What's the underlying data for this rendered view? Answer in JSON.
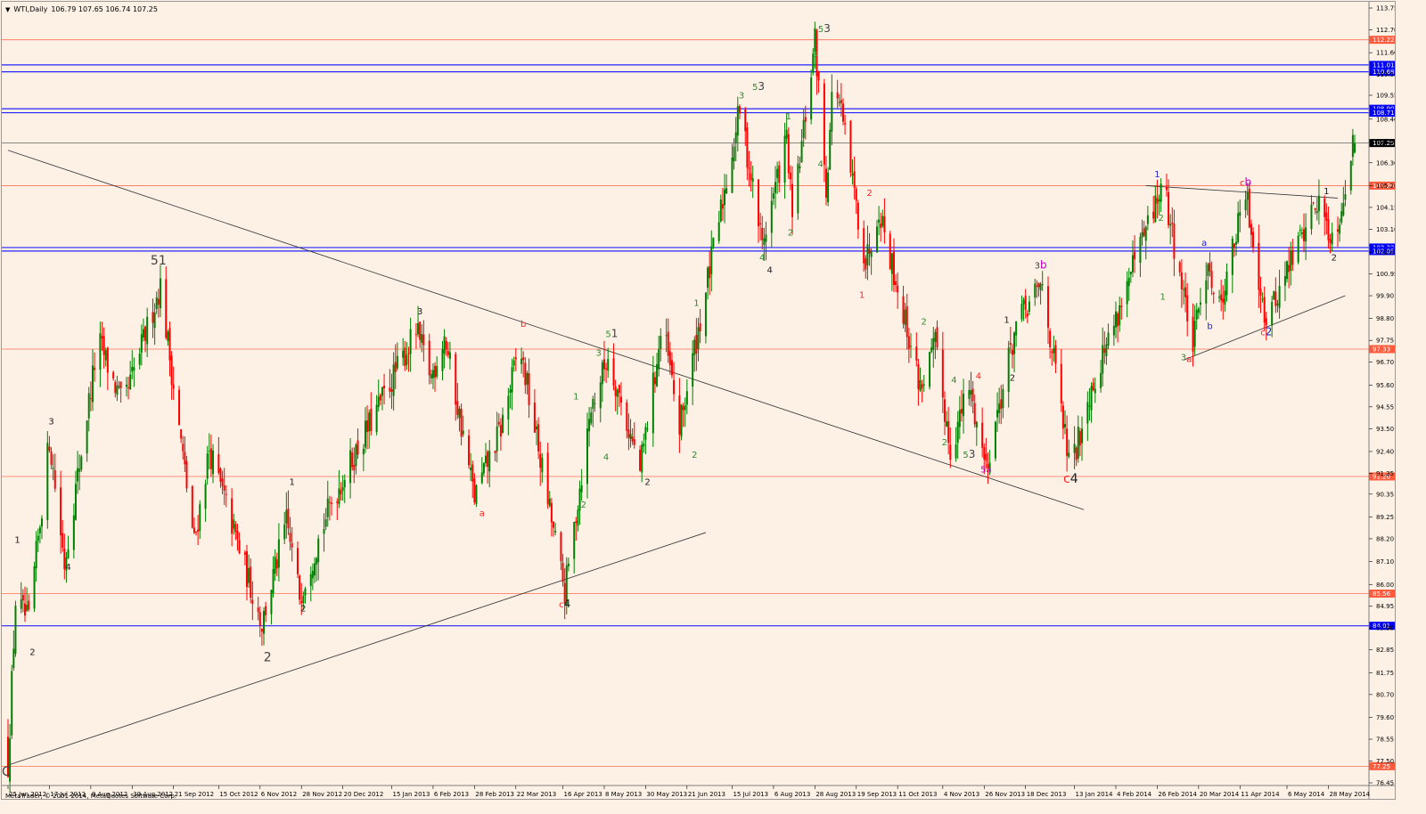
{
  "header": {
    "symbol": "WTI,Daily",
    "ohlc": "106.79 107.65 106.74 107.25"
  },
  "footer": {
    "copyright": "MetaTrader, © 2001-2014, MetaQuotes Software Corp."
  },
  "colors": {
    "background": "#fdf1e6",
    "bull_candle": "#008000",
    "bear_candle": "#ff0000",
    "support_resistance_red": "#ff5a3c",
    "support_resistance_blue": "#0000ff",
    "current_price": "#000000",
    "wave_green": "#2e8b2e",
    "wave_black": "#202020",
    "wave_red": "#ff2020",
    "wave_blue": "#2020d0",
    "wave_magenta": "#c000c0",
    "wave_gray": "#404040"
  },
  "chart_data": {
    "type": "candlestick",
    "symbol": "WTI",
    "timeframe": "Daily",
    "y_ticks": [
      "113.75",
      "112.70",
      "111.60",
      "110.55",
      "109.55",
      "108.40",
      "107.35",
      "106.30",
      "105.20",
      "104.15",
      "103.10",
      "102.00",
      "100.95",
      "99.90",
      "98.80",
      "97.75",
      "96.70",
      "95.60",
      "94.55",
      "93.50",
      "92.40",
      "91.35",
      "90.35",
      "89.25",
      "88.20",
      "87.10",
      "86.00",
      "84.95",
      "83.90",
      "82.85",
      "81.75",
      "80.70",
      "79.60",
      "78.55",
      "77.50",
      "76.45"
    ],
    "x_ticks": [
      "25 Jun 2012",
      "17 Jul 2012",
      "8 Aug 2012",
      "30 Aug 2012",
      "21 Sep 2012",
      "15 Oct 2012",
      "6 Nov 2012",
      "28 Nov 2012",
      "20 Dec 2012",
      "15 Jan 2013",
      "6 Feb 2013",
      "28 Feb 2013",
      "22 Mar 2013",
      "16 Apr 2013",
      "8 May 2013",
      "30 May 2013",
      "21 Jun 2013",
      "15 Jul 2013",
      "6 Aug 2013",
      "28 Aug 2013",
      "19 Sep 2013",
      "11 Oct 2013",
      "4 Nov 2013",
      "26 Nov 2013",
      "18 Dec 2013",
      "13 Jan 2014",
      "4 Feb 2014",
      "26 Feb 2014",
      "20 Mar 2014",
      "11 Apr 2014",
      "6 May 2014",
      "28 May 2014"
    ],
    "price_levels": [
      {
        "value": 112.22,
        "label": "112.22",
        "color": "red"
      },
      {
        "value": 111.01,
        "label": "111.01",
        "color": "blue"
      },
      {
        "value": 110.68,
        "label": "110.68",
        "color": "blue"
      },
      {
        "value": 108.9,
        "label": "108.90",
        "color": "blue"
      },
      {
        "value": 108.71,
        "label": "108.71",
        "color": "blue"
      },
      {
        "value": 107.25,
        "label": "107.25",
        "color": "current"
      },
      {
        "value": 105.2,
        "label": "105.20",
        "color": "red"
      },
      {
        "value": 102.22,
        "label": "102.22",
        "color": "blue"
      },
      {
        "value": 102.05,
        "label": "102.05",
        "color": "blue"
      },
      {
        "value": 97.33,
        "label": "97.33",
        "color": "red"
      },
      {
        "value": 91.2,
        "label": "91.20",
        "color": "red"
      },
      {
        "value": 85.56,
        "label": "85.56",
        "color": "red"
      },
      {
        "value": 84.01,
        "label": "84.01",
        "color": "blue"
      },
      {
        "value": 77.25,
        "label": "77.25",
        "color": "red"
      }
    ],
    "trendlines": [
      {
        "name": "falling-resistance",
        "from": {
          "date": "25 Jun 2012",
          "price": 106.9
        },
        "to": {
          "date": "18 Jan 2014",
          "price": 89.6
        }
      },
      {
        "name": "rising-support",
        "from": {
          "date": "25 Jun 2012",
          "price": 77.3
        },
        "to": {
          "date": "1 Jul 2013",
          "price": 88.5
        }
      },
      {
        "name": "triangle-upper",
        "from": {
          "date": "20 Feb 2014",
          "price": 105.2
        },
        "to": {
          "date": "2 Jun 2014",
          "price": 104.6
        }
      },
      {
        "name": "triangle-lower",
        "from": {
          "date": "12 Mar 2014",
          "price": 96.8
        },
        "to": {
          "date": "6 Jun 2014",
          "price": 99.9
        }
      }
    ],
    "key_swings": [
      {
        "date": "25 Jun 2012",
        "price": 77.3
      },
      {
        "date": "29 Jun 2012",
        "price": 85.2
      },
      {
        "date": "6 Jul 2012",
        "price": 84.2
      },
      {
        "date": "17 Jul 2012",
        "price": 93.0
      },
      {
        "date": "25 Jul 2012",
        "price": 87.0
      },
      {
        "date": "12 Aug 2012",
        "price": 97.8
      },
      {
        "date": "25 Aug 2012",
        "price": 94.5
      },
      {
        "date": "14 Sep 2012",
        "price": 100.4
      },
      {
        "date": "2 Oct 2012",
        "price": 88.0
      },
      {
        "date": "10 Oct 2012",
        "price": 92.5
      },
      {
        "date": "7 Nov 2012",
        "price": 84.1
      },
      {
        "date": "20 Nov 2012",
        "price": 89.0
      },
      {
        "date": "27 Nov 2012",
        "price": 85.5
      },
      {
        "date": "14 Dec 2012",
        "price": 90.0
      },
      {
        "date": "28 Jan 2013",
        "price": 98.2
      },
      {
        "date": "5 Feb 2013",
        "price": 96.0
      },
      {
        "date": "12 Feb 2013",
        "price": 98.0
      },
      {
        "date": "28 Feb 2013",
        "price": 90.2
      },
      {
        "date": "14 Mar 2013",
        "price": 93.5
      },
      {
        "date": "24 Mar 2013",
        "price": 97.5
      },
      {
        "date": "17 Apr 2013",
        "price": 85.6
      },
      {
        "date": "1 May 2013",
        "price": 94.5
      },
      {
        "date": "10 May 2013",
        "price": 97.0
      },
      {
        "date": "27 May 2013",
        "price": 91.5
      },
      {
        "date": "8 Jun 2013",
        "price": 98.5
      },
      {
        "date": "17 Jun 2013",
        "price": 93.5
      },
      {
        "date": "8 Jul 2013",
        "price": 103.5
      },
      {
        "date": "19 Jul 2013",
        "price": 108.9
      },
      {
        "date": "31 Jul 2013",
        "price": 102.4
      },
      {
        "date": "13 Aug 2013",
        "price": 107.5
      },
      {
        "date": "16 Aug 2013",
        "price": 103.5
      },
      {
        "date": "28 Aug 2013",
        "price": 112.2
      },
      {
        "date": "3 Sep 2013",
        "price": 105.0
      },
      {
        "date": "7 Sep 2013",
        "price": 110.8
      },
      {
        "date": "24 Sep 2013",
        "price": 101.5
      },
      {
        "date": "1 Oct 2013",
        "price": 104.2
      },
      {
        "date": "23 Oct 2013",
        "price": 95.5
      },
      {
        "date": "31 Oct 2013",
        "price": 97.5
      },
      {
        "date": "8 Nov 2013",
        "price": 92.5
      },
      {
        "date": "18 Nov 2013",
        "price": 95.5
      },
      {
        "date": "27 Nov 2013",
        "price": 91.7
      },
      {
        "date": "13 Dec 2013",
        "price": 98.5
      },
      {
        "date": "27 Dec 2013",
        "price": 100.4
      },
      {
        "date": "11 Jan 2014",
        "price": 91.3
      },
      {
        "date": "20 Jan 2014",
        "price": 95.0
      },
      {
        "date": "1 Mar 2014",
        "price": 105.3
      },
      {
        "date": "17 Mar 2014",
        "price": 97.5
      },
      {
        "date": "25 Mar 2014",
        "price": 101.8
      },
      {
        "date": "30 Mar 2014",
        "price": 99.0
      },
      {
        "date": "14 Apr 2014",
        "price": 104.8
      },
      {
        "date": "25 Apr 2014",
        "price": 98.6
      },
      {
        "date": "12 May 2014",
        "price": 102.5
      },
      {
        "date": "22 May 2014",
        "price": 104.5
      },
      {
        "date": "31 May 2014",
        "price": 102.5
      },
      {
        "date": "11 Jun 2014",
        "price": 107.6
      }
    ],
    "last_bar": {
      "open": 106.79,
      "high": 107.65,
      "low": 106.74,
      "close": 107.25
    },
    "wave_labels": [
      {
        "date": "24 Jun 2012",
        "price": 76.8,
        "text": "C",
        "color": "gray",
        "size": "large"
      },
      {
        "date": "30 Jun 2012",
        "price": 88.0,
        "text": "1",
        "color": "black",
        "size": "small"
      },
      {
        "date": "8 Jul 2012",
        "price": 82.6,
        "text": "2",
        "color": "black",
        "size": "small"
      },
      {
        "date": "18 Jul 2012",
        "price": 93.7,
        "text": "3",
        "color": "black",
        "size": "small"
      },
      {
        "date": "27 Jul 2012",
        "price": 86.7,
        "text": "4",
        "color": "black",
        "size": "small"
      },
      {
        "date": "13 Sep 2012",
        "price": 101.4,
        "text": "51",
        "color": "gray",
        "size": "large"
      },
      {
        "date": "10 Nov 2012",
        "price": 82.3,
        "text": "2",
        "color": "gray",
        "size": "large"
      },
      {
        "date": "23 Nov 2012",
        "price": 90.8,
        "text": "1",
        "color": "black",
        "size": "small"
      },
      {
        "date": "29 Nov 2012",
        "price": 84.7,
        "text": "2",
        "color": "black",
        "size": "small"
      },
      {
        "date": "30 Jan 2013",
        "price": 99.0,
        "text": "3",
        "color": "black",
        "size": "small"
      },
      {
        "date": "4 Mar 2013",
        "price": 89.3,
        "text": "a",
        "color": "red",
        "size": "small"
      },
      {
        "date": "26 Mar 2013",
        "price": 98.4,
        "text": "b",
        "color": "red",
        "size": "small"
      },
      {
        "date": "17 Apr 2013",
        "price": 84.9,
        "text": "c4",
        "color": "mixed",
        "size": "small"
      },
      {
        "date": "23 Apr 2013",
        "price": 94.9,
        "text": "1",
        "color": "green",
        "size": "small"
      },
      {
        "date": "27 Apr 2013",
        "price": 89.7,
        "text": "2",
        "color": "green",
        "size": "small"
      },
      {
        "date": "5 May 2013",
        "price": 97.0,
        "text": "3",
        "color": "green",
        "size": "small"
      },
      {
        "date": "9 May 2013",
        "price": 92.0,
        "text": "4",
        "color": "green",
        "size": "small"
      },
      {
        "date": "12 May 2013",
        "price": 97.9,
        "text": "51",
        "color": "mixed",
        "size": "small"
      },
      {
        "date": "31 May 2013",
        "price": 90.8,
        "text": "2",
        "color": "black",
        "size": "small"
      },
      {
        "date": "25 Jun 2013",
        "price": 92.1,
        "text": "2",
        "color": "green",
        "size": "small"
      },
      {
        "date": "26 Jun 2013",
        "price": 99.4,
        "text": "1",
        "color": "green",
        "size": "small"
      },
      {
        "date": "20 Jul 2013",
        "price": 109.4,
        "text": "3",
        "color": "green",
        "size": "small"
      },
      {
        "date": "29 Jul 2013",
        "price": 109.8,
        "text": "53",
        "color": "mixed",
        "size": "small"
      },
      {
        "date": "31 Jul 2013",
        "price": 101.6,
        "text": "4",
        "color": "green",
        "size": "small"
      },
      {
        "date": "4 Aug 2013",
        "price": 101.0,
        "text": "4",
        "color": "black",
        "size": "small"
      },
      {
        "date": "14 Aug 2013",
        "price": 108.4,
        "text": "1",
        "color": "green",
        "size": "small"
      },
      {
        "date": "15 Aug 2013",
        "price": 102.8,
        "text": "2",
        "color": "green",
        "size": "small"
      },
      {
        "date": "28 Aug 2013",
        "price": 111.4,
        "text": "3",
        "color": "green",
        "size": "small"
      },
      {
        "date": "31 Aug 2013",
        "price": 106.1,
        "text": "4",
        "color": "green",
        "size": "small"
      },
      {
        "date": "2 Sep 2013",
        "price": 112.6,
        "text": "53",
        "color": "mixed",
        "size": "small"
      },
      {
        "date": "22 Sep 2013",
        "price": 99.8,
        "text": "1",
        "color": "red",
        "size": "small"
      },
      {
        "date": "26 Sep 2013",
        "price": 104.7,
        "text": "2",
        "color": "red",
        "size": "small"
      },
      {
        "date": "23 Oct 2013",
        "price": 95.4,
        "text": "1",
        "color": "green",
        "size": "small"
      },
      {
        "date": "25 Oct 2013",
        "price": 98.5,
        "text": "2",
        "color": "green",
        "size": "small"
      },
      {
        "date": "5 Nov 2013",
        "price": 92.7,
        "text": "2",
        "color": "green",
        "size": "small"
      },
      {
        "date": "10 Nov 2013",
        "price": 95.7,
        "text": "4",
        "color": "green",
        "size": "small"
      },
      {
        "date": "18 Nov 2013",
        "price": 92.1,
        "text": "53",
        "color": "mixed",
        "size": "small"
      },
      {
        "date": "23 Nov 2013",
        "price": 95.9,
        "text": "4",
        "color": "red",
        "size": "small"
      },
      {
        "date": "27 Nov 2013",
        "price": 91.4,
        "text": "5a",
        "color": "magenta",
        "size": "small"
      },
      {
        "date": "8 Dec 2013",
        "price": 98.6,
        "text": "1",
        "color": "black",
        "size": "small"
      },
      {
        "date": "11 Dec 2013",
        "price": 95.8,
        "text": "2",
        "color": "black",
        "size": "small"
      },
      {
        "date": "26 Dec 2013",
        "price": 101.2,
        "text": "3b",
        "color": "mixed",
        "size": "small"
      },
      {
        "date": "11 Jan 2014",
        "price": 90.9,
        "text": "c4",
        "color": "mixed",
        "size": "large"
      },
      {
        "date": "26 Feb 2014",
        "price": 105.6,
        "text": "1",
        "color": "blue",
        "size": "small"
      },
      {
        "date": "28 Feb 2014",
        "price": 103.5,
        "text": "2",
        "color": "green",
        "size": "small"
      },
      {
        "date": "1 Mar 2014",
        "price": 99.7,
        "text": "1",
        "color": "green",
        "size": "small"
      },
      {
        "date": "12 Mar 2014",
        "price": 96.8,
        "text": "3",
        "color": "green",
        "size": "small"
      },
      {
        "date": "15 Mar 2014",
        "price": 96.7,
        "text": "a",
        "color": "red",
        "size": "small"
      },
      {
        "date": "23 Mar 2014",
        "price": 102.3,
        "text": "a",
        "color": "blue",
        "size": "small"
      },
      {
        "date": "26 Mar 2014",
        "price": 98.3,
        "text": "b",
        "color": "blue",
        "size": "small"
      },
      {
        "date": "14 Apr 2014",
        "price": 105.2,
        "text": "cb",
        "color": "mixed",
        "size": "small"
      },
      {
        "date": "25 Apr 2014",
        "price": 98.0,
        "text": "c2",
        "color": "mixed",
        "size": "small"
      },
      {
        "date": "27 May 2014",
        "price": 104.8,
        "text": "1",
        "color": "black",
        "size": "small"
      },
      {
        "date": "31 May 2014",
        "price": 101.6,
        "text": "2",
        "color": "black",
        "size": "small"
      }
    ]
  }
}
